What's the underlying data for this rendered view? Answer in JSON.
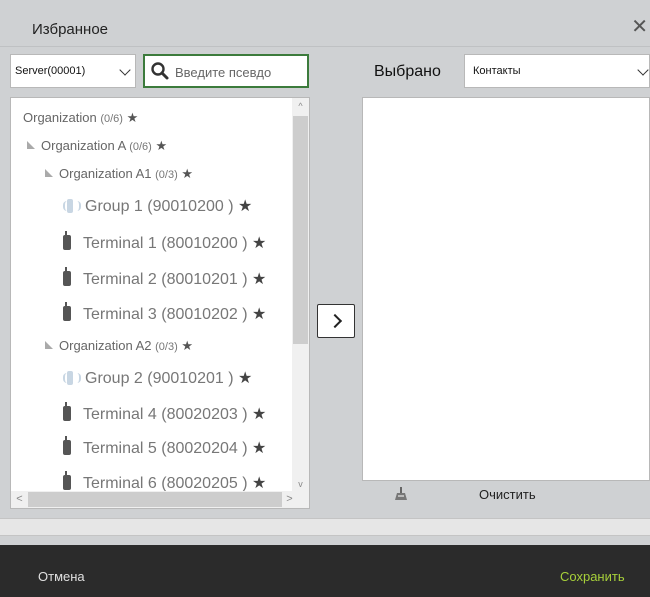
{
  "dialog": {
    "title": "Избранное",
    "close_glyph": "✕"
  },
  "server_select": {
    "value": "Server(00001)"
  },
  "search": {
    "placeholder": "Введите псевдо"
  },
  "tree": {
    "items": [
      {
        "label": "Organization",
        "count": "(0/6)",
        "star": "★"
      },
      {
        "label": "Organization A",
        "count": "(0/6)",
        "star": "★"
      },
      {
        "label": "Organization A1",
        "count": "(0/3)",
        "star": "★"
      },
      {
        "label": "Group 1 (90010200 )",
        "star": "★"
      },
      {
        "label": "Terminal 1 (80010200 )",
        "star": "★"
      },
      {
        "label": "Terminal 2 (80010201 )",
        "star": "★"
      },
      {
        "label": "Terminal 3 (80010202 )",
        "star": "★"
      },
      {
        "label": "Organization A2",
        "count": "(0/3)",
        "star": "★"
      },
      {
        "label": "Group 2 (90010201 )",
        "star": "★"
      },
      {
        "label": "Terminal 4 (80020203 )",
        "star": "★"
      },
      {
        "label": "Terminal 5 (80020204 )",
        "star": "★"
      },
      {
        "label": "Terminal 6 (80020205 )",
        "star": "★"
      }
    ],
    "scroll": {
      "up": "^",
      "down": "v",
      "left": "<",
      "right": ">"
    }
  },
  "transfer_button": {
    "icon": "chevron-right-icon"
  },
  "selected_panel": {
    "label": "Выбрано",
    "dropdown_value": "Контакты",
    "clear_label": "Очистить"
  },
  "footer": {
    "cancel_label": "Отмена",
    "save_label": "Сохранить",
    "save_color": "#a7d03a"
  }
}
